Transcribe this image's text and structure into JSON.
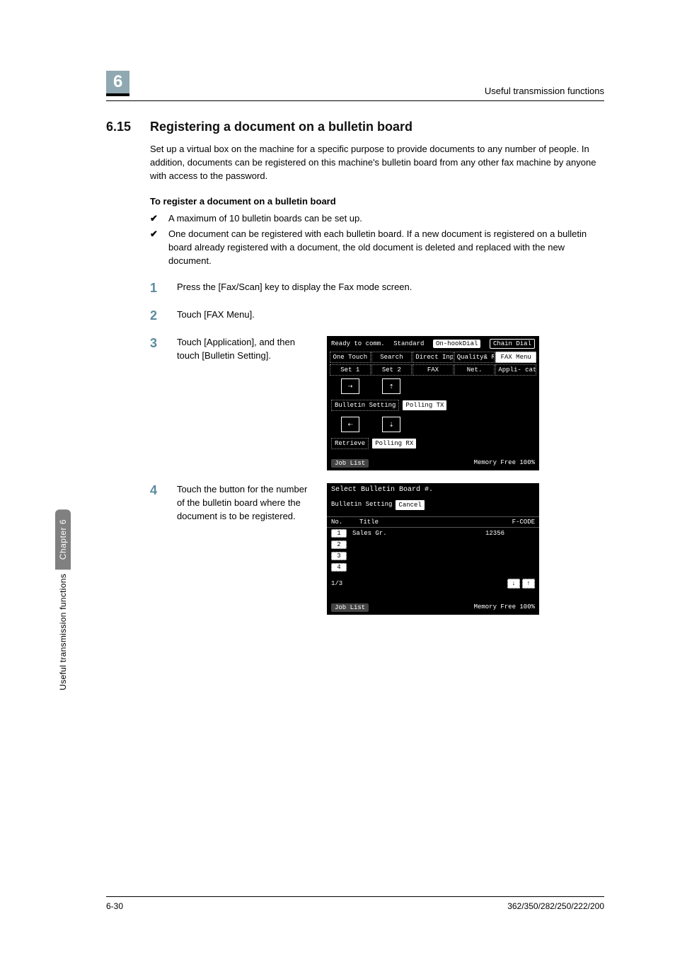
{
  "chapter_number": "6",
  "running_header": "Useful transmission functions",
  "section": {
    "number": "6.15",
    "title": "Registering a document on a bulletin board",
    "intro": "Set up a virtual box on the machine for a specific purpose to provide documents to any number of people. In addition, documents can be registered on this machine's bulletin board from any other fax machine by anyone with access to the password."
  },
  "subheading": "To register a document on a bulletin board",
  "bullets": [
    "A maximum of 10 bulletin boards can be set up.",
    "One document can be registered with each bulletin board. If a new document is registered on a bulletin board already registered with a document, the old document is deleted and replaced with the new document."
  ],
  "steps": [
    {
      "num": "1",
      "text": "Press the [Fax/Scan] key to display the Fax mode screen."
    },
    {
      "num": "2",
      "text": "Touch [FAX Menu]."
    },
    {
      "num": "3",
      "text": "Touch [Application], and then touch [Bulletin Setting]."
    },
    {
      "num": "4",
      "text": "Touch the button for the number of the bulletin board where the document is to be registered."
    }
  ],
  "screen1": {
    "ready": "Ready\nto comm.",
    "standard": "Standard",
    "onhook": "On-hookDial",
    "chain": "Chain Dial",
    "tabs_top": [
      "One Touch",
      "Search",
      "Direct Input",
      "Quality& Reduction",
      "FAX Menu"
    ],
    "tabs_mid": [
      "Set 1",
      "Set 2",
      "FAX",
      "Net.",
      "Appli- cation"
    ],
    "bulletin": "Bulletin Setting",
    "pollingtx": "Polling TX",
    "retrieve": "Retrieve",
    "pollingrx": "Polling RX",
    "joblist": "Job List",
    "memory": "Memory Free 100%"
  },
  "screen2": {
    "title": "Select Bulletin Board #.",
    "setting": "Bulletin Setting",
    "cancel": "Cancel",
    "col_no": "No.",
    "col_title": "Title",
    "col_fcode": "F-CODE",
    "rows": [
      {
        "n": "1",
        "title": "Sales Gr.",
        "fcode": "12356"
      },
      {
        "n": "2",
        "title": "",
        "fcode": ""
      },
      {
        "n": "3",
        "title": "",
        "fcode": ""
      },
      {
        "n": "4",
        "title": "",
        "fcode": ""
      }
    ],
    "page": "1/3",
    "joblist": "Job List",
    "memory": "Memory Free 100%"
  },
  "vtab": {
    "top": "Chapter 6",
    "bottom": "Useful transmission functions"
  },
  "footer": {
    "left": "6-30",
    "right": "362/350/282/250/222/200"
  }
}
